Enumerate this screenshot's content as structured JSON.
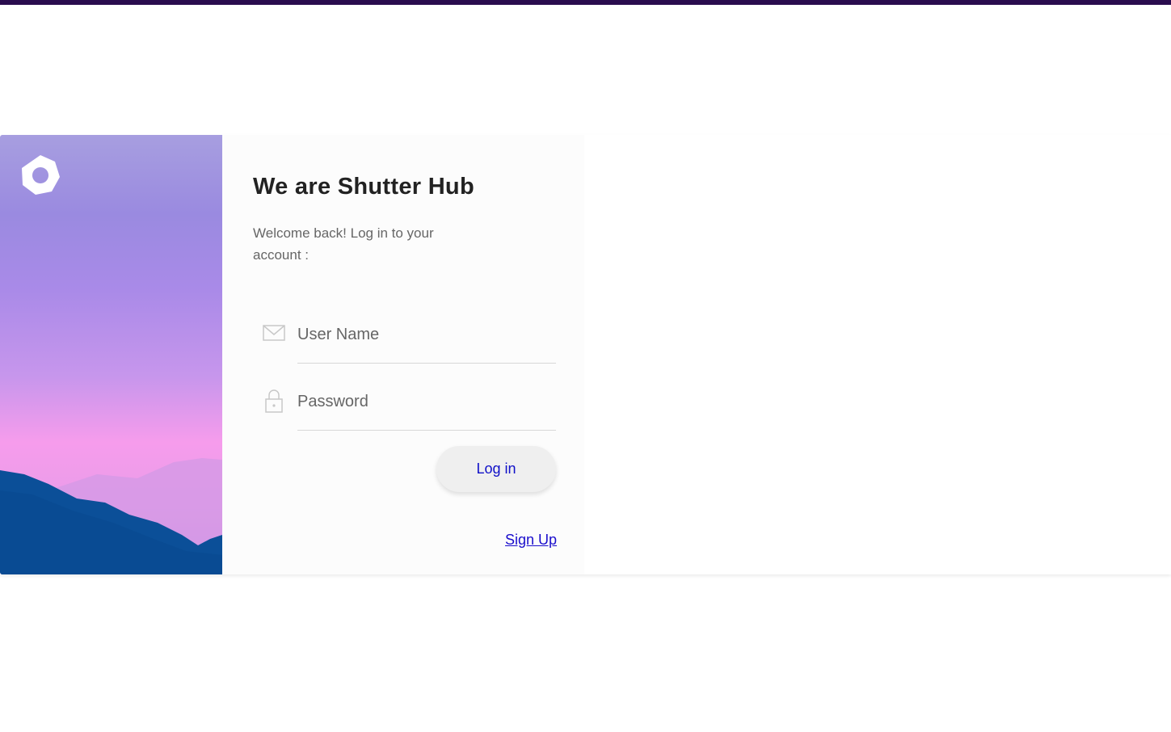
{
  "colors": {
    "top_bar": "#2a0c4e",
    "link": "#1a0dcc",
    "title": "#222222",
    "subtitle": "#666666"
  },
  "brand": {
    "logo_icon": "heptagon-ring-logo-icon"
  },
  "login": {
    "title": "We are Shutter Hub",
    "subtitle": "Welcome back! Log in to your account :",
    "username_placeholder": "User Name",
    "username_icon": "envelope-icon",
    "password_placeholder": "Password",
    "password_icon": "lock-icon",
    "login_label": "Log in",
    "signup_label": "Sign Up"
  }
}
